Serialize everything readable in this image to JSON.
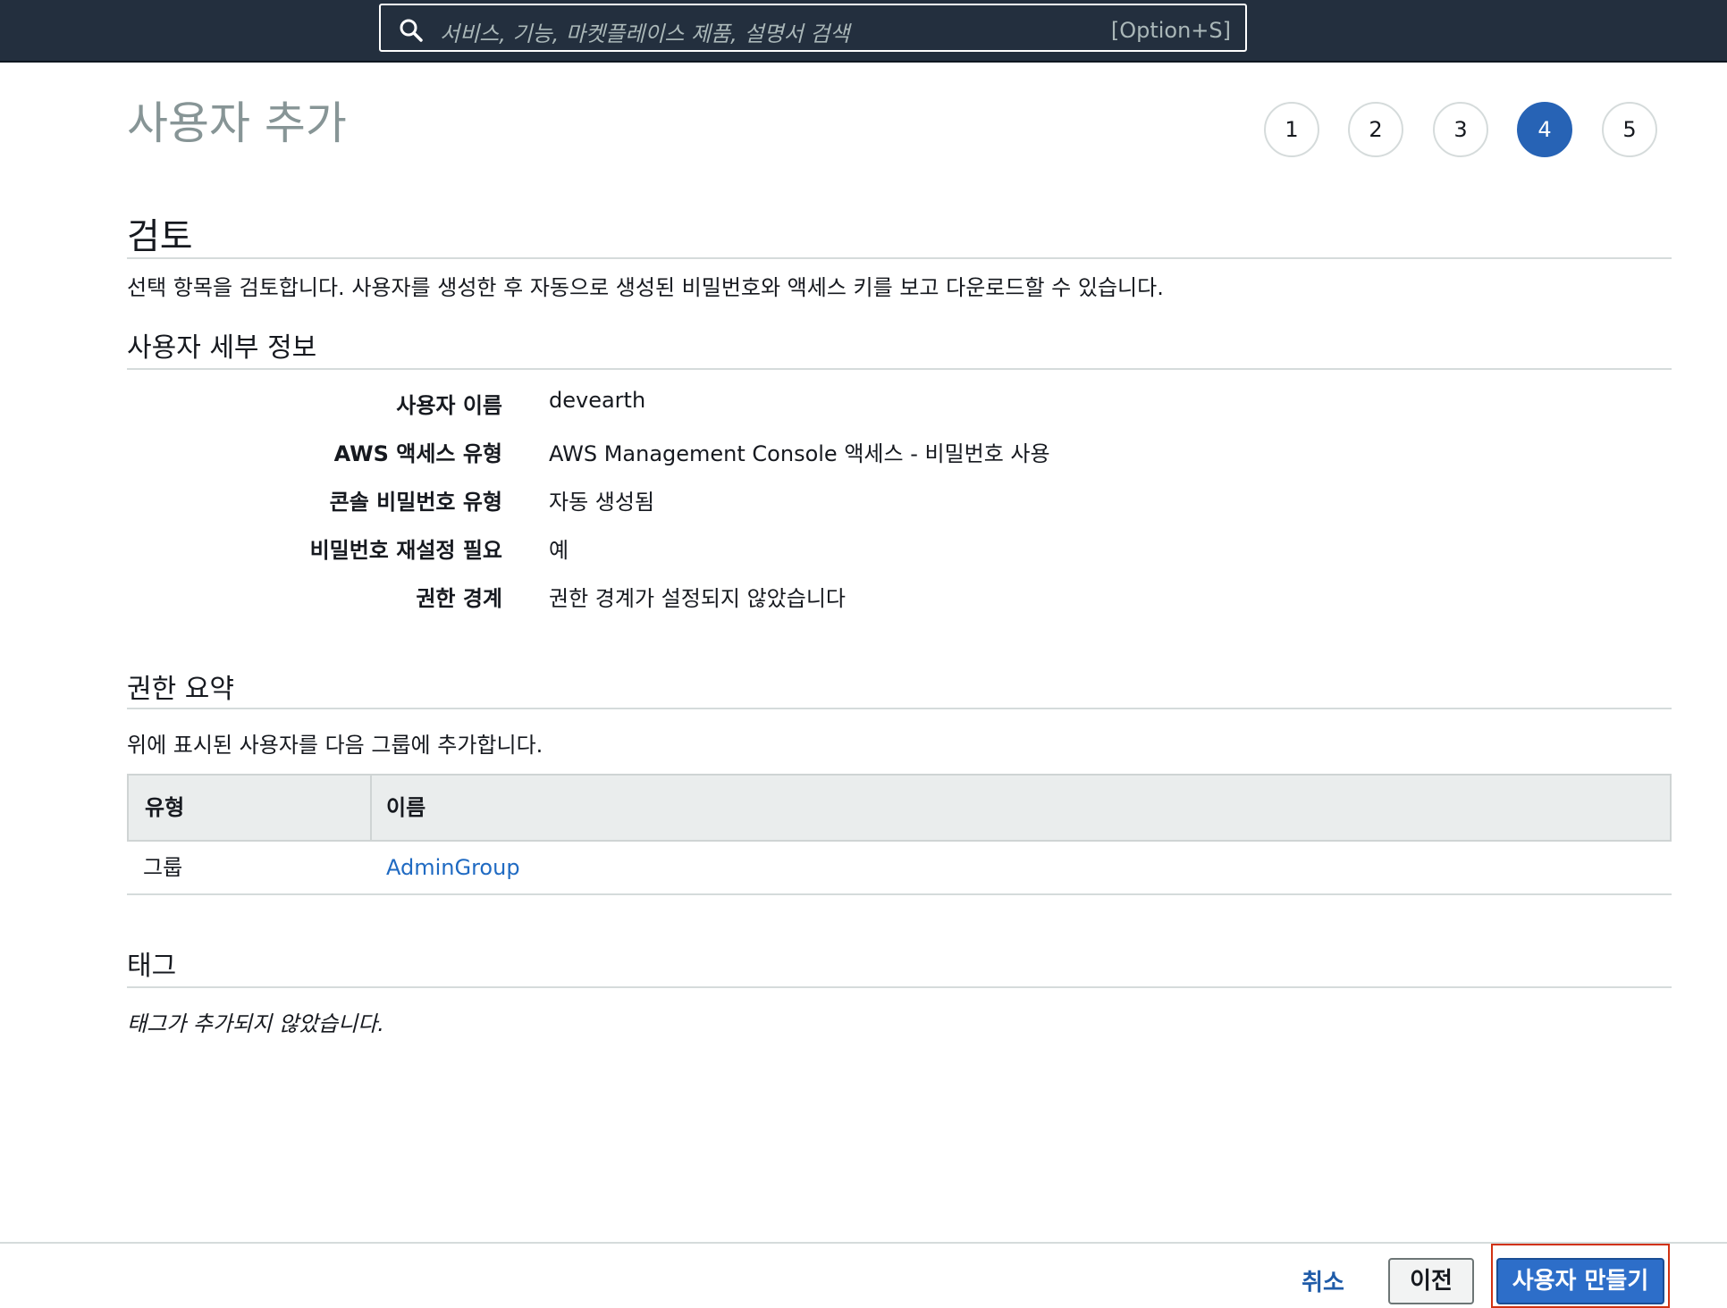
{
  "search": {
    "placeholder": "서비스, 기능, 마켓플레이스 제품, 설명서 검색",
    "shortcut": "[Option+S]"
  },
  "page": {
    "title": "사용자 추가"
  },
  "steps": [
    "1",
    "2",
    "3",
    "4",
    "5"
  ],
  "current_step": 4,
  "review": {
    "title": "검토",
    "description": "선택 항목을 검토합니다. 사용자를 생성한 후 자동으로 생성된 비밀번호와 액세스 키를 보고 다운로드할 수 있습니다."
  },
  "details": {
    "title": "사용자 세부 정보",
    "rows": [
      {
        "label": "사용자 이름",
        "value": "devearth"
      },
      {
        "label": "AWS 액세스 유형",
        "value": "AWS Management Console 액세스 - 비밀번호 사용"
      },
      {
        "label": "콘솔 비밀번호 유형",
        "value": "자동 생성됨"
      },
      {
        "label": "비밀번호 재설정 필요",
        "value": "예"
      },
      {
        "label": "권한 경계",
        "value": "권한 경계가 설정되지 않았습니다"
      }
    ]
  },
  "permissions": {
    "title": "권한 요약",
    "description": "위에 표시된 사용자를 다음 그룹에 추가합니다.",
    "columns": [
      "유형",
      "이름"
    ],
    "rows": [
      {
        "type": "그룹",
        "name": "AdminGroup"
      }
    ]
  },
  "tags": {
    "title": "태그",
    "empty": "태그가 추가되지 않았습니다."
  },
  "footer": {
    "cancel": "취소",
    "previous": "이전",
    "create": "사용자 만들기"
  },
  "colors": {
    "topbar": "#232f3e",
    "accent": "#2763b5",
    "link": "#1f6ac2",
    "highlight": "#d13212"
  },
  "icons": {
    "search": "search-icon"
  }
}
